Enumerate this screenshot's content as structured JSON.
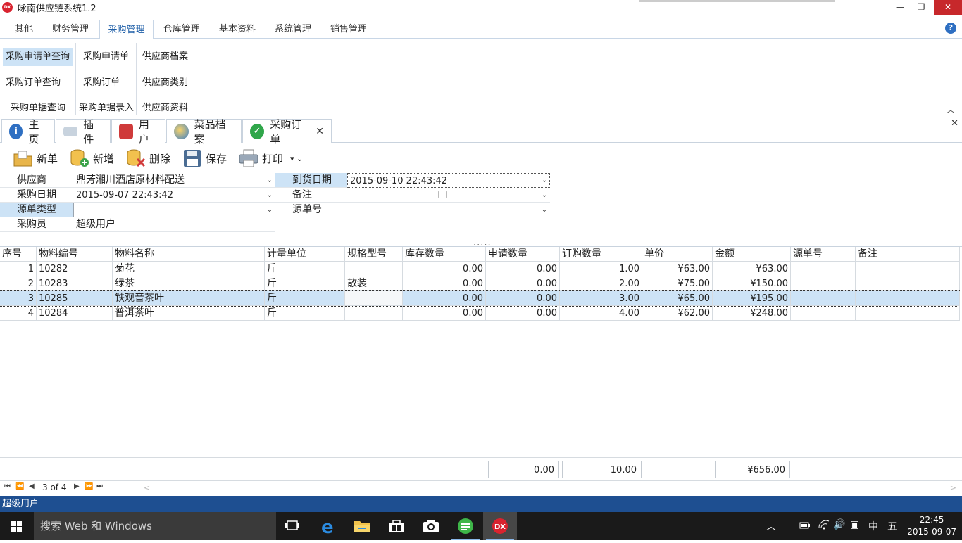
{
  "window": {
    "title": "咏南供应链系统1.2",
    "logo": "DX",
    "minimize": "—",
    "restore": "❐",
    "close": "✕"
  },
  "ribbon": {
    "tabs": [
      {
        "label": "其他"
      },
      {
        "label": "财务管理"
      },
      {
        "label": "采购管理"
      },
      {
        "label": "仓库管理"
      },
      {
        "label": "基本资料"
      },
      {
        "label": "系统管理"
      },
      {
        "label": "销售管理"
      }
    ],
    "help": "?",
    "group1": [
      "采购申请单查询",
      "采购订单查询",
      "采购单据查询"
    ],
    "group2": [
      "采购申请单",
      "采购订单",
      "采购单据录入"
    ],
    "group3": [
      "供应商档案",
      "供应商类别",
      "供应商资料"
    ],
    "collapse": "︿"
  },
  "doc_tabs": [
    {
      "label": "主页",
      "icon": "info-icon"
    },
    {
      "label": "插件",
      "icon": "plugin-icon"
    },
    {
      "label": "用户",
      "icon": "users-icon"
    },
    {
      "label": "菜品档案",
      "icon": "globe-icon"
    },
    {
      "label": "采购订单",
      "icon": "check-icon"
    }
  ],
  "doc_tab_close": "✕",
  "doc_close": "✕",
  "toolbar": {
    "new_doc": "新单",
    "add": "新增",
    "delete": "删除",
    "save": "保存",
    "print": "打印",
    "dropdown": "▾ ⌄"
  },
  "form": {
    "supplier_label": "供应商",
    "supplier_value": "鼎芳湘川酒店原材料配送",
    "arrival_label": "到货日期",
    "arrival_value": "2015-09-10 22:43:42",
    "purchase_date_label": "采购日期",
    "purchase_date_value": "2015-09-07 22:43:42",
    "remark_label": "备注",
    "remark_value": "",
    "source_type_label": "源单类型",
    "source_type_value": "",
    "source_no_label": "源单号",
    "source_no_value": "",
    "buyer_label": "采购员",
    "buyer_value": "超级用户",
    "drop_arrow": "⌄",
    "splitter": "....."
  },
  "grid": {
    "columns": [
      "序号",
      "物料编号",
      "物料名称",
      "计量单位",
      "规格型号",
      "库存数量",
      "申请数量",
      "订购数量",
      "单价",
      "金额",
      "源单号",
      "备注"
    ],
    "rows": [
      {
        "seq": "1",
        "code": "10282",
        "name": "菊花",
        "unit": "斤",
        "spec": "",
        "stock": "0.00",
        "apply": "0.00",
        "order": "1.00",
        "price": "¥63.00",
        "amount": "¥63.00",
        "src": "",
        "remark": ""
      },
      {
        "seq": "2",
        "code": "10283",
        "name": "绿茶",
        "unit": "斤",
        "spec": "散装",
        "stock": "0.00",
        "apply": "0.00",
        "order": "2.00",
        "price": "¥75.00",
        "amount": "¥150.00",
        "src": "",
        "remark": ""
      },
      {
        "seq": "3",
        "code": "10285",
        "name": "铁观音茶叶",
        "unit": "斤",
        "spec": "",
        "stock": "0.00",
        "apply": "0.00",
        "order": "3.00",
        "price": "¥65.00",
        "amount": "¥195.00",
        "src": "",
        "remark": ""
      },
      {
        "seq": "4",
        "code": "10284",
        "name": "普洱茶叶",
        "unit": "斤",
        "spec": "",
        "stock": "0.00",
        "apply": "0.00",
        "order": "4.00",
        "price": "¥62.00",
        "amount": "¥248.00",
        "src": "",
        "remark": ""
      }
    ],
    "selected_row": 2
  },
  "footer": {
    "apply_sum": "0.00",
    "order_sum": "10.00",
    "amount_sum": "¥656.00"
  },
  "navigator": {
    "first": "⏮",
    "prev_page": "⏪",
    "prev": "◀",
    "position": "3 of 4",
    "next": "▶",
    "next_page": "⏩",
    "last": "⏭",
    "scroll_left": "<",
    "scroll_right": ">"
  },
  "status": {
    "user": "超级用户"
  },
  "taskbar": {
    "search_placeholder": "搜索 Web 和 Windows",
    "tray_ime": "中",
    "tray_ime2": "五",
    "time": "22:45",
    "date": "2015-09-07",
    "tray_up": "︿",
    "tray_volume": "🔊",
    "tray_message": "▣"
  },
  "colors": {
    "accent": "#1f5fa8",
    "selection": "#cde3f6",
    "status_bar": "#1e4f91",
    "close_button": "#c7282b",
    "taskbar": "#1a1a1a"
  }
}
